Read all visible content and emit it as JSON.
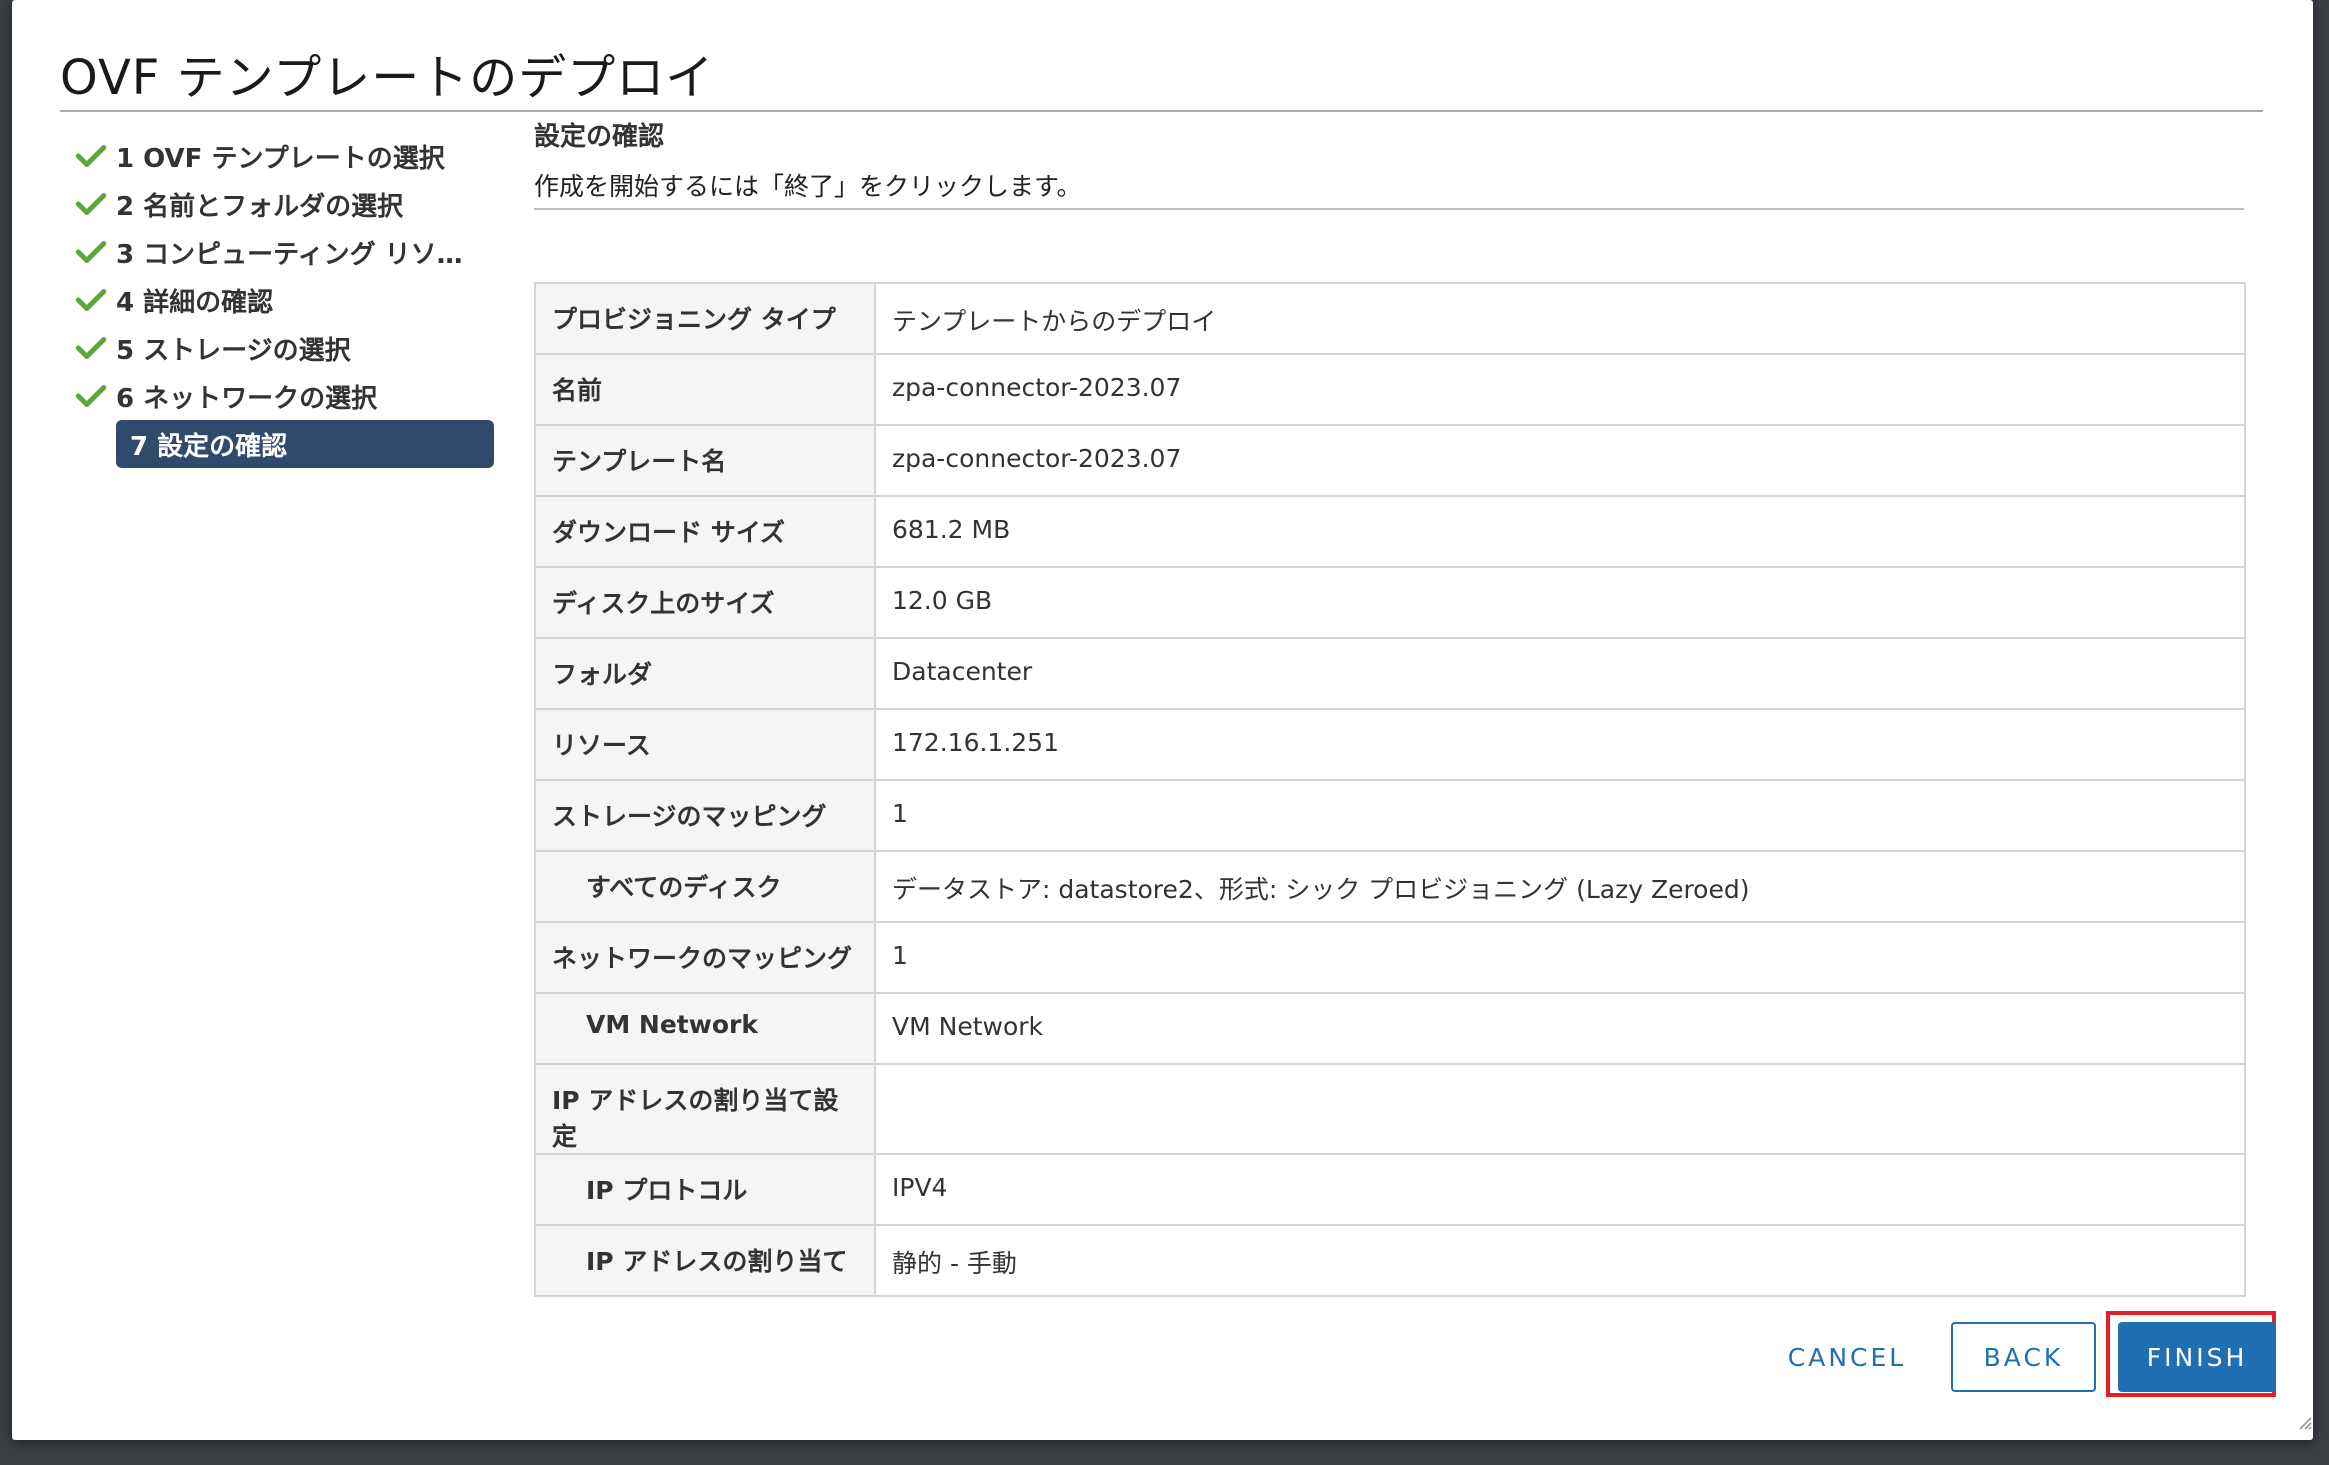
{
  "dialog": {
    "title": "OVF テンプレートのデプロイ"
  },
  "steps": [
    {
      "label": "1 OVF テンプレートの選択",
      "done": true
    },
    {
      "label": "2 名前とフォルダの選択",
      "done": true
    },
    {
      "label": "3 コンピューティング リソー...",
      "done": true
    },
    {
      "label": "4 詳細の確認",
      "done": true
    },
    {
      "label": "5 ストレージの選択",
      "done": true
    },
    {
      "label": "6 ネットワークの選択",
      "done": true
    },
    {
      "label": "7 設定の確認",
      "done": false,
      "active": true
    }
  ],
  "section": {
    "title": "設定の確認",
    "description": "作成を開始するには「終了」をクリックします。"
  },
  "summary": [
    {
      "key": "プロビジョニング タイプ",
      "value": "テンプレートからのデプロイ"
    },
    {
      "key": "名前",
      "value": "zpa-connector-2023.07"
    },
    {
      "key": "テンプレート名",
      "value": "zpa-connector-2023.07"
    },
    {
      "key": "ダウンロード サイズ",
      "value": "681.2 MB"
    },
    {
      "key": "ディスク上のサイズ",
      "value": "12.0 GB"
    },
    {
      "key": "フォルダ",
      "value": "Datacenter"
    },
    {
      "key": "リソース",
      "value": "172.16.1.251"
    },
    {
      "key": "ストレージのマッピング",
      "value": "1"
    },
    {
      "key": "すべてのディスク",
      "value": "データストア: datastore2、形式: シック プロビジョニング (Lazy Zeroed)"
    },
    {
      "key": "ネットワークのマッピング",
      "value": "1"
    },
    {
      "key": "VM Network",
      "value": "VM Network"
    },
    {
      "key": "IP アドレスの割り当て設定",
      "value": ""
    },
    {
      "key": "IP プロトコル",
      "value": "IPV4"
    },
    {
      "key": "IP アドレスの割り当て",
      "value": "静的 - 手動"
    }
  ],
  "buttons": {
    "cancel": "CANCEL",
    "back": "BACK",
    "finish": "FINISH"
  },
  "colors": {
    "accent": "#1f6fb2",
    "active_step": "#2f4a6b",
    "check": "#5aa832",
    "highlight": "#e0202a"
  },
  "icons": {
    "step_done": "check-icon",
    "resize": "resize-grip-icon"
  }
}
